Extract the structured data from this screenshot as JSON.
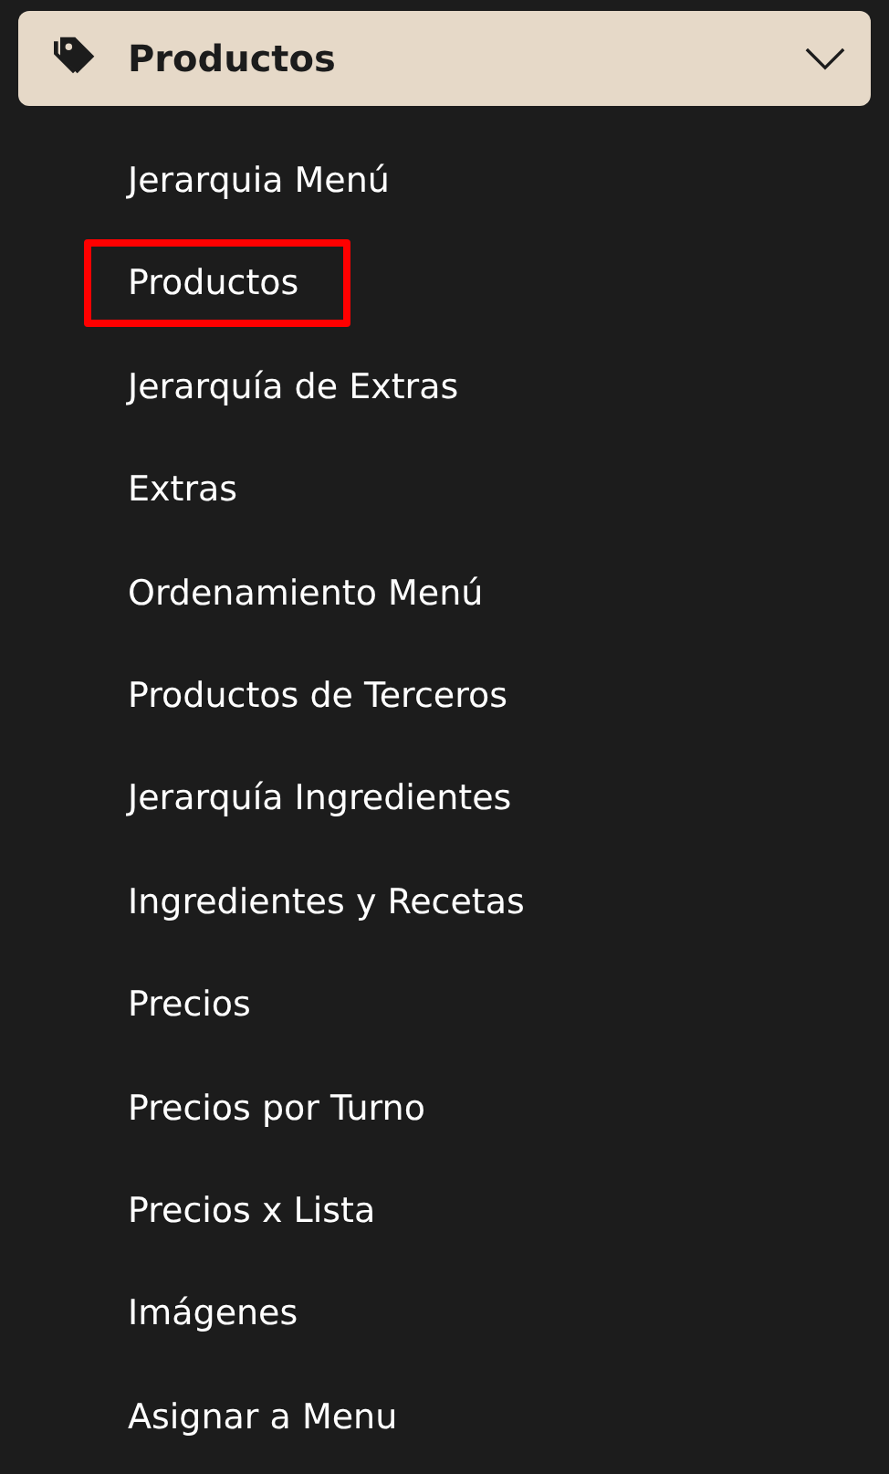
{
  "menu_header": {
    "label": "Productos",
    "expanded": true
  },
  "items": [
    {
      "label": "Jerarquia Menú",
      "highlighted": false
    },
    {
      "label": "Productos",
      "highlighted": true
    },
    {
      "label": "Jerarquía de Extras",
      "highlighted": false
    },
    {
      "label": "Extras",
      "highlighted": false
    },
    {
      "label": "Ordenamiento Menú",
      "highlighted": false
    },
    {
      "label": "Productos de Terceros",
      "highlighted": false
    },
    {
      "label": "Jerarquía Ingredientes",
      "highlighted": false
    },
    {
      "label": "Ingredientes y Recetas",
      "highlighted": false
    },
    {
      "label": "Precios",
      "highlighted": false
    },
    {
      "label": "Precios por Turno",
      "highlighted": false
    },
    {
      "label": "Precios x Lista",
      "highlighted": false
    },
    {
      "label": "Imágenes",
      "highlighted": false
    },
    {
      "label": "Asignar a Menu",
      "highlighted": false
    }
  ]
}
